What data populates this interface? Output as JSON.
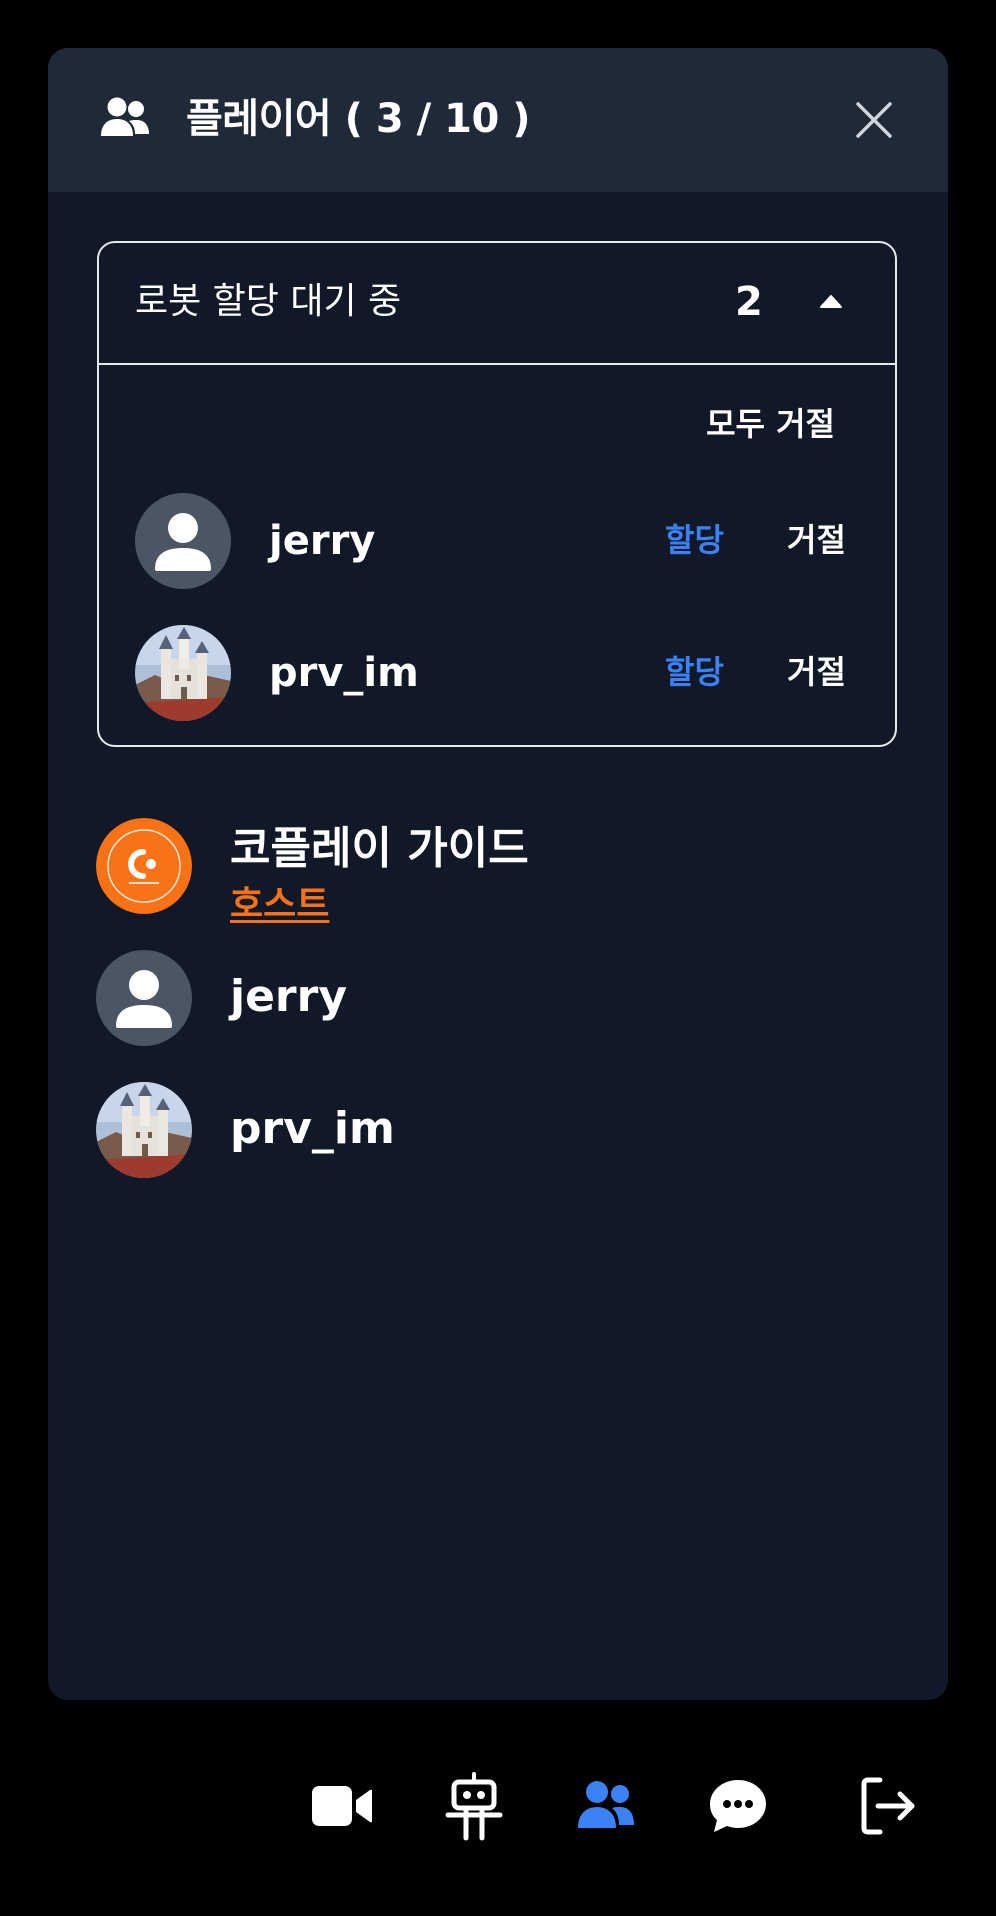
{
  "header": {
    "title": "플레이어 ( 3 / 10 )",
    "icon": "users-icon",
    "close_icon": "close-icon"
  },
  "waiting": {
    "title": "로봇 할당 대기 중",
    "count": "2",
    "toggle_icon": "caret-up-icon",
    "reject_all": "모두 거절",
    "requests": [
      {
        "name": "jerry",
        "avatar": "default-user-avatar",
        "assign": "할당",
        "reject": "거절"
      },
      {
        "name": "prv_im",
        "avatar": "castle-photo-avatar",
        "assign": "할당",
        "reject": "거절"
      }
    ]
  },
  "players": [
    {
      "name": "코플레이 가이드",
      "role": "호스트",
      "avatar": "coplay-logo-avatar"
    },
    {
      "name": "jerry",
      "avatar": "default-user-avatar"
    },
    {
      "name": "prv_im",
      "avatar": "castle-photo-avatar"
    }
  ],
  "bottom_nav": [
    {
      "icon": "video-camera-icon",
      "active": false
    },
    {
      "icon": "robot-icon",
      "active": false
    },
    {
      "icon": "users-icon",
      "active": true
    },
    {
      "icon": "chat-bubble-icon",
      "active": false
    },
    {
      "icon": "exit-icon",
      "active": false
    }
  ],
  "colors": {
    "background": "#000000",
    "panel": "#111827",
    "panel_header": "#1f2937",
    "accent_blue": "#3b82f6",
    "host_orange": "#f97316",
    "avatar_gray": "#4b5563"
  }
}
